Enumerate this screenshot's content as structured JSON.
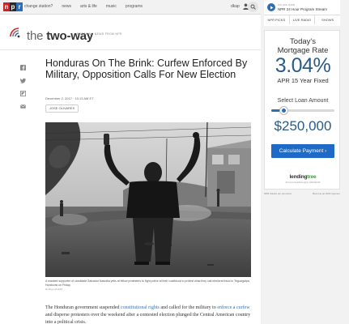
{
  "nav": {
    "logo_letters": [
      "n",
      "p",
      "r"
    ],
    "logo_colors": [
      "#d62021",
      "#2b2b2b",
      "#2e6db4"
    ],
    "links": [
      "change station?",
      "news",
      "arts & life",
      "music",
      "programs"
    ],
    "user_label": "dkap",
    "user_icon": "user-icon",
    "search_icon": "search-icon"
  },
  "blog": {
    "logo_icon": "radio-waves-icon",
    "title_the": "the",
    "title_main": "two-way",
    "tagline": "BREAKING NEWS FROM NPR"
  },
  "share": [
    "facebook-icon",
    "twitter-icon",
    "flipboard-icon",
    "email-icon"
  ],
  "article": {
    "headline": "Honduras On The Brink: Curfew Enforced By Military, Opposition Calls For New Election",
    "date": "December 2, 2017 · 10:13 AM ET",
    "author": "JOSE OLIVARES",
    "caption": "A masked supporter of candidate Salvador Nasralla yells at fellow protesters to fight police at their roadblock to protest what they call electoral fraud in Tegucigalpa, Honduras on Friday.",
    "credit": "Rodrigo Abd/AP",
    "body_lead": "The Honduran government suspended ",
    "body_link1": "constitutional rights",
    "body_mid": " and called for the military to ",
    "body_link2": "enforce a curfew",
    "body_tail": " and disperse protesters over the weekend after a contested election plunged the Central American country into a political crisis."
  },
  "live": {
    "play_icon": "play-icon",
    "on_air": "ON AIR NOW",
    "program": "NPR 24 Hour Program Stream",
    "tabs": [
      "NPR PICKS",
      "LIVE RADIO",
      "SHOWS"
    ]
  },
  "ad": {
    "line1": "Today's",
    "line2": "Mortgage Rate",
    "rate": "3.04%",
    "apr": "APR 15 Year Fixed",
    "slider_label": "Select Loan Amount",
    "slider_fraction": 0.2,
    "amount": "$250,000",
    "button": "Calculate Payment ›",
    "brand_lending": "lending",
    "brand_tree": "tree",
    "fine": "Terms & Conditions apply. NMLS#1136",
    "footer_left": "NPR thanks our sponsors",
    "footer_right": "Become an NPR sponsor"
  },
  "colors": {
    "accent": "#2e6db4",
    "rate": "#2a5b86",
    "button": "#1f6ac6"
  }
}
